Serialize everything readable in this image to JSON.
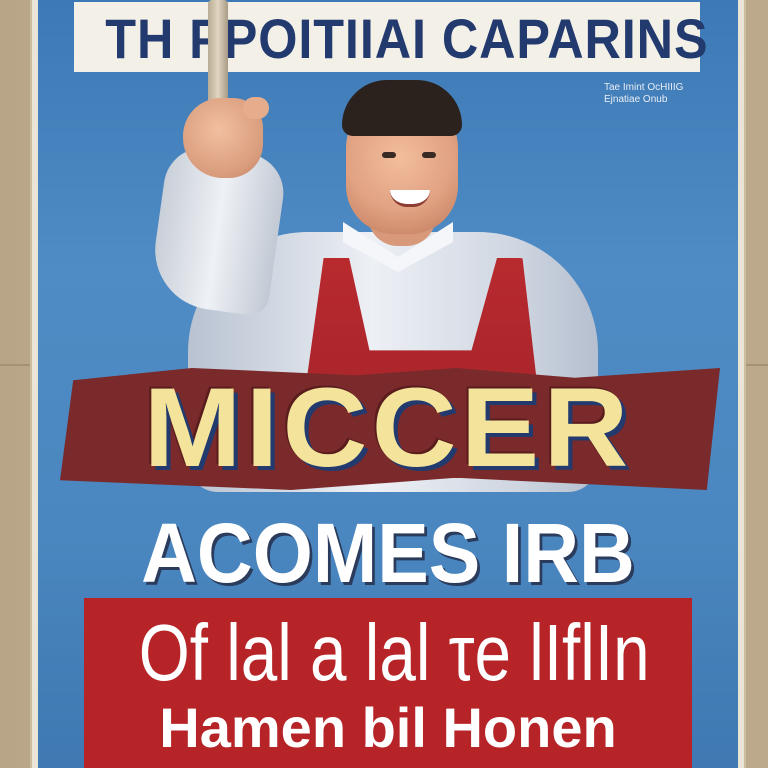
{
  "poster": {
    "top_title": "TH  PPOITIIAI CAPARINS",
    "side_note": [
      "Tae Imint OcHIIIG",
      "Ejnatiae Onub"
    ],
    "headline": "MICCER",
    "subhead": "ACOMES IRB",
    "red_box": {
      "line1": "Of lal a lal τe lIflIn",
      "line2": "Hamen bil Honen"
    }
  },
  "colors": {
    "poster_blue": "#4a86bf",
    "banner_text": "#223a6e",
    "headline_yellow": "#f3e39b",
    "red": "#b62428",
    "apron_red": "#b82a2e"
  }
}
